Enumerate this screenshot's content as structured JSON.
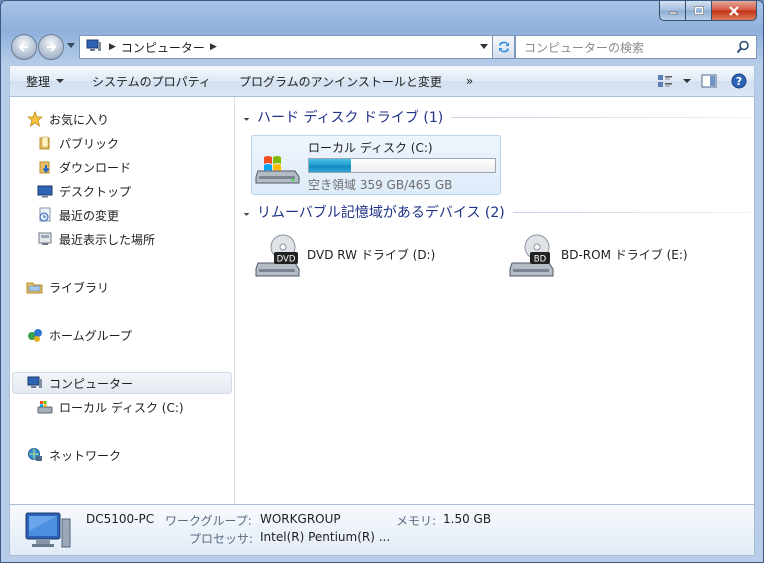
{
  "window": {
    "address_text": "コンピューター",
    "search_placeholder": "コンピューターの検索"
  },
  "commands": {
    "organize": "整理",
    "system_properties": "システムのプロパティ",
    "uninstall": "プログラムのアンインストールと変更",
    "more": "»"
  },
  "nav": {
    "favorites": "お気に入り",
    "public": "パブリック",
    "downloads": "ダウンロード",
    "desktop": "デスクトップ",
    "recent_changes": "最近の変更",
    "recent_places": "最近表示した場所",
    "libraries": "ライブラリ",
    "homegroup": "ホームグループ",
    "computer": "コンピューター",
    "local_disk": "ローカル ディスク (C:)",
    "network": "ネットワーク"
  },
  "groups": {
    "hdd": "ハード ディスク ドライブ (1)",
    "removable": "リムーバブル記憶域があるデバイス (2)"
  },
  "drives": {
    "c": {
      "name": "ローカル ディスク (C:)",
      "free": "空き領域 359 GB/465 GB",
      "used_fraction": 0.228
    },
    "d": {
      "name": "DVD RW ドライブ (D:)",
      "badge": "DVD"
    },
    "e": {
      "name": "BD-ROM ドライブ (E:)",
      "badge": "BD"
    }
  },
  "details": {
    "pc_name": "DC5100-PC",
    "workgroup_label": "ワークグループ:",
    "workgroup_value": "WORKGROUP",
    "memory_label": "メモリ:",
    "memory_value": "1.50 GB",
    "processor_label": "プロセッサ:",
    "processor_value": "Intel(R) Pentium(R) ..."
  },
  "colors": {
    "group_header": "#1e3287",
    "selection_bg": "#deebf9",
    "progress_fill": "#1d9bcf"
  }
}
